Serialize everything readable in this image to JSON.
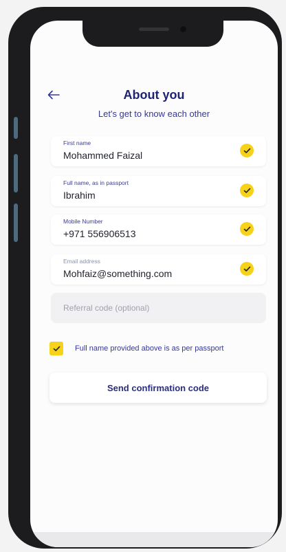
{
  "header": {
    "title": "About you",
    "subtitle": "Let's get to know each other"
  },
  "form": {
    "first_name": {
      "label": "First name",
      "value": "Mohammed Faizal",
      "verified": true
    },
    "passport_name": {
      "label": "Full name, as in passport",
      "value": "Ibrahim",
      "verified": true
    },
    "mobile": {
      "label": "Mobile Number",
      "value": "+971  556906513",
      "verified": true
    },
    "email": {
      "label": "Email address",
      "value": "Mohfaiz@something.com",
      "verified": true
    },
    "referral": {
      "placeholder": "Referral code (optional)",
      "value": ""
    },
    "passport_confirm": {
      "label": "Full name provided above is as per passport",
      "checked": true
    }
  },
  "actions": {
    "send_label": "Send confirmation code"
  },
  "colors": {
    "primary": "#1f2270",
    "accent": "#f6d21a",
    "field_bg": "#ffffff",
    "screen_bg": "#fcfcfc"
  },
  "icons": {
    "back": "arrow-left-icon",
    "verified": "check-circle-icon",
    "checkbox": "checkbox-checked-icon"
  }
}
